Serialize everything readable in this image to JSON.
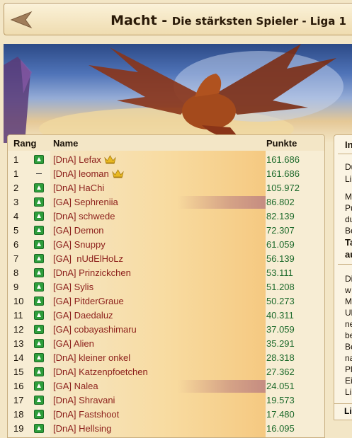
{
  "header": {
    "title_main": "Macht - ",
    "title_sub": "Die stärksten Spieler - Liga 1"
  },
  "table": {
    "columns": {
      "rank": "Rang",
      "name": "Name",
      "points": "Punkte"
    },
    "rows": [
      {
        "rank": "1",
        "trend": "up",
        "name": "[DnA] Lefax",
        "crown": true,
        "points": "161.686",
        "highlight": false
      },
      {
        "rank": "1",
        "trend": "same",
        "name": "[DnA] leoman",
        "crown": true,
        "points": "161.686",
        "highlight": false
      },
      {
        "rank": "2",
        "trend": "up",
        "name": "[DnA] HaChi",
        "crown": false,
        "points": "105.972",
        "highlight": false
      },
      {
        "rank": "3",
        "trend": "up",
        "name": "[GA] Sephreniia",
        "crown": false,
        "points": "86.802",
        "highlight": true
      },
      {
        "rank": "4",
        "trend": "up",
        "name": "[DnA] schwede",
        "crown": false,
        "points": "82.139",
        "highlight": false
      },
      {
        "rank": "5",
        "trend": "up",
        "name": "[GA] Demon",
        "crown": false,
        "points": "72.307",
        "highlight": false
      },
      {
        "rank": "6",
        "trend": "up",
        "name": "[GA] Snuppy",
        "crown": false,
        "points": "61.059",
        "highlight": false
      },
      {
        "rank": "7",
        "trend": "up",
        "name": "[GA]  nUdElHoLz",
        "crown": false,
        "points": "56.139",
        "highlight": false
      },
      {
        "rank": "8",
        "trend": "up",
        "name": "[DnA] Prinzickchen",
        "crown": false,
        "points": "53.111",
        "highlight": false
      },
      {
        "rank": "9",
        "trend": "up",
        "name": "[GA] Sylis",
        "crown": false,
        "points": "51.208",
        "highlight": false
      },
      {
        "rank": "10",
        "trend": "up",
        "name": "[GA] PitderGraue",
        "crown": false,
        "points": "50.273",
        "highlight": false
      },
      {
        "rank": "11",
        "trend": "up",
        "name": "[GA] Daedaluz",
        "crown": false,
        "points": "40.311",
        "highlight": false
      },
      {
        "rank": "12",
        "trend": "up",
        "name": "[GA] cobayashimaru",
        "crown": false,
        "points": "37.059",
        "highlight": false
      },
      {
        "rank": "13",
        "trend": "up",
        "name": "[GA] Alien",
        "crown": false,
        "points": "35.291",
        "highlight": false
      },
      {
        "rank": "14",
        "trend": "up",
        "name": "[DnA] kleiner onkel",
        "crown": false,
        "points": "28.318",
        "highlight": false
      },
      {
        "rank": "15",
        "trend": "up",
        "name": "[DnA] Katzenpfoetchen",
        "crown": false,
        "points": "27.362",
        "highlight": false
      },
      {
        "rank": "16",
        "trend": "up",
        "name": "[GA] Nalea",
        "crown": false,
        "points": "24.051",
        "highlight": true
      },
      {
        "rank": "17",
        "trend": "up",
        "name": "[DnA] Shravani",
        "crown": false,
        "points": "19.573",
        "highlight": false
      },
      {
        "rank": "18",
        "trend": "up",
        "name": "[DnA] Fastshoot",
        "crown": false,
        "points": "17.480",
        "highlight": false
      },
      {
        "rank": "19",
        "trend": "up",
        "name": "[DnA] Hellsing",
        "crown": false,
        "points": "16.095",
        "highlight": false
      }
    ]
  },
  "info_panel": {
    "title": "In",
    "lines": [
      "Du",
      "Li",
      "M",
      "Pu",
      "du",
      "Be",
      "Ta",
      "au",
      "Di",
      "w",
      "M",
      "Ul",
      "ne",
      "be",
      "Be",
      "na",
      "Pl",
      "Ei",
      "Li"
    ],
    "footer": "Li"
  },
  "colors": {
    "name_text": "#8c1f1b",
    "points_text": "#1d6a2b",
    "trend_up": "#2e9e3c",
    "crown": "#e8b820",
    "background": "#f3e6c6"
  }
}
